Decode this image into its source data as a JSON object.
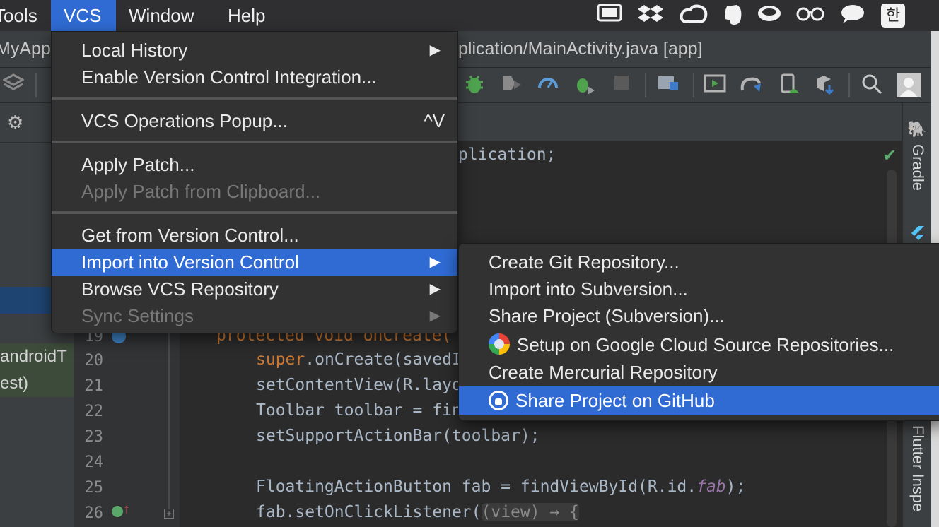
{
  "menubar": {
    "items": [
      "Tools",
      "VCS",
      "Window",
      "Help"
    ],
    "active": "VCS",
    "tray_icons": [
      "display-icon",
      "dropbox-icon",
      "creative-cloud-icon",
      "evernote-icon",
      "coffee-icon",
      "glasses-icon",
      "chat-bubble-icon",
      "korean-input-icon"
    ],
    "korean_input_label": "한"
  },
  "window": {
    "title_left": "MyApp",
    "title_right": "plication/MainActivity.java [app]"
  },
  "vcs_menu": {
    "items": [
      {
        "label": "Local History",
        "has_submenu": true,
        "enabled": true
      },
      {
        "label": "Enable Version Control Integration...",
        "has_submenu": false,
        "enabled": true
      },
      {
        "label": "VCS Operations Popup...",
        "shortcut": "^V",
        "enabled": true
      },
      {
        "label": "Apply Patch...",
        "enabled": true
      },
      {
        "label": "Apply Patch from Clipboard...",
        "enabled": false
      },
      {
        "label": "Get from Version Control...",
        "enabled": true
      },
      {
        "label": "Import into Version Control",
        "has_submenu": true,
        "enabled": true,
        "highlighted": true
      },
      {
        "label": "Browse VCS Repository",
        "has_submenu": true,
        "enabled": true
      },
      {
        "label": "Sync Settings",
        "has_submenu": true,
        "enabled": false
      }
    ]
  },
  "import_submenu": {
    "items": [
      {
        "label": "Create Git Repository..."
      },
      {
        "label": "Import into Subversion..."
      },
      {
        "label": "Share Project (Subversion)..."
      },
      {
        "label": "Setup on Google Cloud Source Repositories...",
        "icon": "google-cloud-icon"
      },
      {
        "label": "Create Mercurial Repository"
      },
      {
        "label": "Share Project on GitHub",
        "icon": "github-icon",
        "highlighted": true
      }
    ]
  },
  "left_panel": {
    "rows": [
      "androidT",
      "est)"
    ]
  },
  "editor": {
    "package_fragment": "plication;",
    "line_numbers": [
      "19",
      "20",
      "21",
      "22",
      "23",
      "24",
      "25",
      "26"
    ],
    "lines": {
      "l19_kw": "protected void onCreate(",
      "l20_kw": "super",
      "l20_rest": ".onCreate(savedI",
      "l21": "setContentView(R.layo",
      "l22": "Toolbar toolbar = fin",
      "l23": "setSupportActionBar(toolbar);",
      "l25_a": "FloatingActionButton fab = findViewById(R.id.",
      "l25_field": "fab",
      "l25_b": ");",
      "l26_a": "fab.setOnClickListener(",
      "l26_hint": "(view) → {"
    }
  },
  "right_tool_windows": {
    "gradle": "Gradle",
    "flutter": "Flutter Inspe"
  },
  "colors": {
    "menu_highlight": "#2f6bd3",
    "menu_bg": "#323232",
    "editor_bg": "#2b2b2b",
    "keyword": "#cc7832"
  }
}
